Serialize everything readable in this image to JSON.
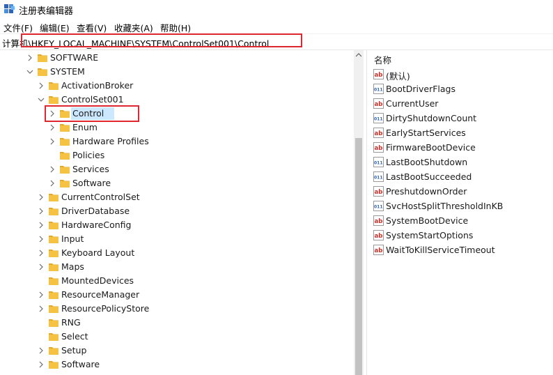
{
  "window": {
    "title": "注册表编辑器"
  },
  "menu": [
    {
      "label": "文件(F)"
    },
    {
      "label": "编辑(E)"
    },
    {
      "label": "查看(V)"
    },
    {
      "label": "收藏夹(A)"
    },
    {
      "label": "帮助(H)"
    }
  ],
  "address": {
    "path": "计算机\\HKEY_LOCAL_MACHINE\\SYSTEM\\ControlSet001\\Control"
  },
  "tree": [
    {
      "label": "SOFTWARE",
      "depth": 0,
      "state": "collapsed"
    },
    {
      "label": "SYSTEM",
      "depth": 0,
      "state": "expanded"
    },
    {
      "label": "ActivationBroker",
      "depth": 1,
      "state": "collapsed"
    },
    {
      "label": "ControlSet001",
      "depth": 1,
      "state": "expanded"
    },
    {
      "label": "Control",
      "depth": 2,
      "state": "collapsed",
      "selected": true
    },
    {
      "label": "Enum",
      "depth": 2,
      "state": "collapsed"
    },
    {
      "label": "Hardware Profiles",
      "depth": 2,
      "state": "collapsed"
    },
    {
      "label": "Policies",
      "depth": 2,
      "state": "leaf"
    },
    {
      "label": "Services",
      "depth": 2,
      "state": "collapsed"
    },
    {
      "label": "Software",
      "depth": 2,
      "state": "collapsed"
    },
    {
      "label": "CurrentControlSet",
      "depth": 1,
      "state": "collapsed"
    },
    {
      "label": "DriverDatabase",
      "depth": 1,
      "state": "collapsed"
    },
    {
      "label": "HardwareConfig",
      "depth": 1,
      "state": "collapsed"
    },
    {
      "label": "Input",
      "depth": 1,
      "state": "collapsed"
    },
    {
      "label": "Keyboard Layout",
      "depth": 1,
      "state": "collapsed"
    },
    {
      "label": "Maps",
      "depth": 1,
      "state": "collapsed"
    },
    {
      "label": "MountedDevices",
      "depth": 1,
      "state": "leaf"
    },
    {
      "label": "ResourceManager",
      "depth": 1,
      "state": "collapsed"
    },
    {
      "label": "ResourcePolicyStore",
      "depth": 1,
      "state": "collapsed"
    },
    {
      "label": "RNG",
      "depth": 1,
      "state": "leaf"
    },
    {
      "label": "Select",
      "depth": 1,
      "state": "leaf"
    },
    {
      "label": "Setup",
      "depth": 1,
      "state": "collapsed"
    },
    {
      "label": "Software",
      "depth": 1,
      "state": "collapsed"
    }
  ],
  "values": {
    "header": "名称",
    "items": [
      {
        "name": "(默认)",
        "icon": "string-value-icon"
      },
      {
        "name": "BootDriverFlags",
        "icon": "binary-value-icon"
      },
      {
        "name": "CurrentUser",
        "icon": "string-value-icon"
      },
      {
        "name": "DirtyShutdownCount",
        "icon": "binary-value-icon"
      },
      {
        "name": "EarlyStartServices",
        "icon": "string-value-icon"
      },
      {
        "name": "FirmwareBootDevice",
        "icon": "string-value-icon"
      },
      {
        "name": "LastBootShutdown",
        "icon": "binary-value-icon"
      },
      {
        "name": "LastBootSucceeded",
        "icon": "binary-value-icon"
      },
      {
        "name": "PreshutdownOrder",
        "icon": "string-value-icon"
      },
      {
        "name": "SvcHostSplitThresholdInKB",
        "icon": "binary-value-icon"
      },
      {
        "name": "SystemBootDevice",
        "icon": "string-value-icon"
      },
      {
        "name": "SystemStartOptions",
        "icon": "string-value-icon"
      },
      {
        "name": "WaitToKillServiceTimeout",
        "icon": "string-value-icon"
      }
    ]
  },
  "colors": {
    "folder": "#f5c242",
    "folder_dark": "#e0a82e",
    "highlight_box": "#e0262f",
    "selection": "#cce8ff",
    "string_icon": "#c4342d",
    "binary_icon": "#2f64b6"
  }
}
